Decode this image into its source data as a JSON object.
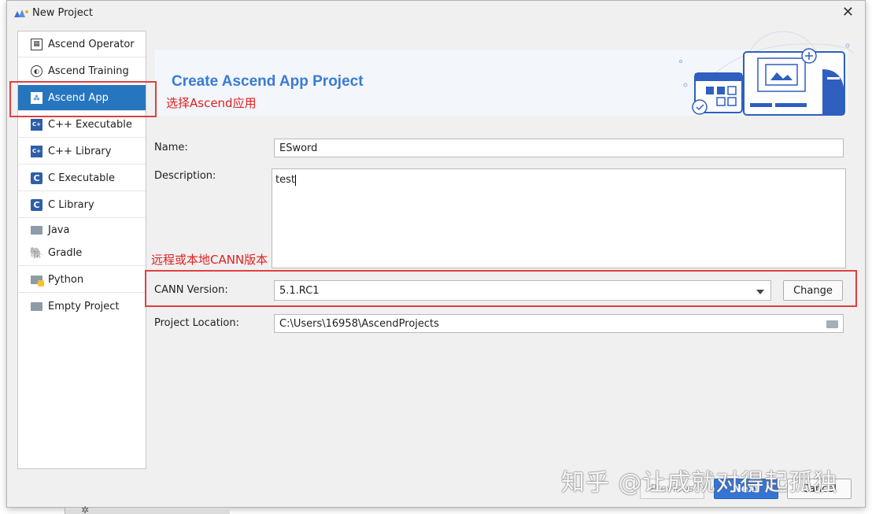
{
  "window": {
    "title": "New Project"
  },
  "sidebar": {
    "items": [
      {
        "label": "Ascend Operator",
        "icon": "ascend-operator-icon",
        "selected": false
      },
      {
        "label": "Ascend Training",
        "icon": "ascend-training-icon",
        "selected": false
      },
      {
        "label": "Ascend App",
        "icon": "ascend-app-icon",
        "selected": true
      },
      {
        "label": "C++ Executable",
        "icon": "cpp-executable-icon",
        "selected": false
      },
      {
        "label": "C++ Library",
        "icon": "cpp-library-icon",
        "selected": false
      },
      {
        "label": "C Executable",
        "icon": "c-executable-icon",
        "selected": false
      },
      {
        "label": "C Library",
        "icon": "c-library-icon",
        "selected": false
      },
      {
        "label": "Java",
        "icon": "java-folder-icon",
        "selected": false
      },
      {
        "label": "Gradle",
        "icon": "gradle-icon",
        "selected": false
      },
      {
        "label": "Python",
        "icon": "python-folder-icon",
        "selected": false
      },
      {
        "label": "Empty Project",
        "icon": "empty-project-folder-icon",
        "selected": false
      }
    ]
  },
  "banner": {
    "title": "Create Ascend App Project"
  },
  "annotations": {
    "select_app": "选择Ascend应用",
    "cann_note": "远程或本地CANN版本"
  },
  "form": {
    "name": {
      "label": "Name:",
      "value": "ESword"
    },
    "description": {
      "label": "Description:",
      "value": "test"
    },
    "cann_version": {
      "label": "CANN Version:",
      "value": "5.1.RC1",
      "change_label": "Change"
    },
    "project_location": {
      "label": "Project Location:",
      "value": "C:\\Users\\16958\\AscendProjects"
    }
  },
  "footer": {
    "previous_label": "Previous",
    "next_label": "Next",
    "cancel_label": "Cancel"
  },
  "watermark": "知乎 @让成就对得起孤独",
  "colors": {
    "accent": "#2675bf",
    "banner_title": "#3a7bd5",
    "annotation": "#e02020",
    "primary_button": "#3574d4"
  }
}
